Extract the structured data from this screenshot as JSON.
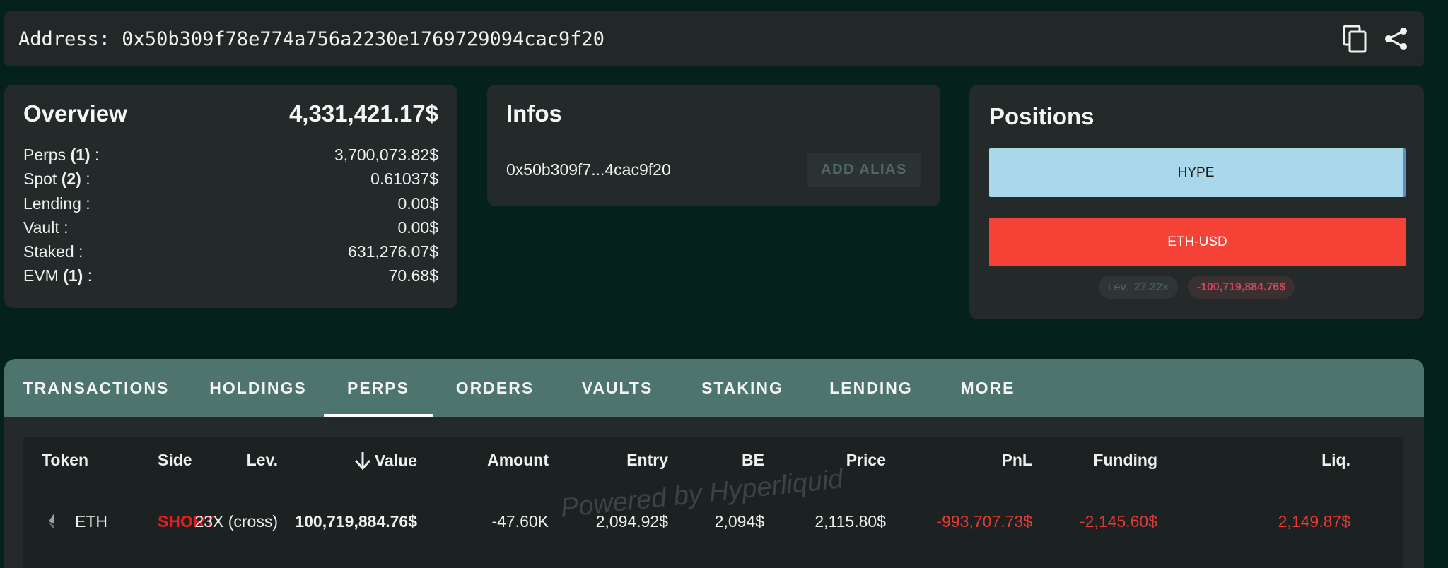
{
  "address_bar": {
    "label": "Address: 0x50b309f78e774a756a2230e1769729094cac9f20",
    "copy_icon": "copy-icon",
    "share_icon": "share-icon"
  },
  "overview": {
    "title": "Overview",
    "total": "4,331,421.17$",
    "rows": [
      {
        "label": "Perps ",
        "count": "(1)",
        "suffix": " :",
        "value": "3,700,073.82$"
      },
      {
        "label": "Spot ",
        "count": "(2)",
        "suffix": " :",
        "value": "0.61037$"
      },
      {
        "label": "Lending :",
        "count": "",
        "suffix": "",
        "value": "0.00$"
      },
      {
        "label": "Vault :",
        "count": "",
        "suffix": "",
        "value": "0.00$"
      },
      {
        "label": "Staked :",
        "count": "",
        "suffix": "",
        "value": "631,276.07$"
      },
      {
        "label": "EVM ",
        "count": "(1)",
        "suffix": " :",
        "value": "70.68$"
      }
    ]
  },
  "infos": {
    "title": "Infos",
    "short_address": "0x50b309f7...4cac9f20",
    "alias_button": "ADD ALIAS"
  },
  "positions": {
    "title": "Positions",
    "items": [
      "HYPE",
      "ETH-USD"
    ],
    "leverage_label": "Lev.",
    "leverage_value": "27.22x",
    "pnl": "-100,719,884.76$"
  },
  "tabs": [
    "TRANSACTIONS",
    "HOLDINGS",
    "PERPS",
    "ORDERS",
    "VAULTS",
    "STAKING",
    "LENDING",
    "MORE"
  ],
  "active_tab": "PERPS",
  "table": {
    "headers": [
      "Token",
      "Side",
      "Lev.",
      "Value",
      "Amount",
      "Entry",
      "BE",
      "Price",
      "PnL",
      "Funding",
      "Liq."
    ],
    "sort_icon": "arrow-down-icon",
    "watermark": "Powered by Hyperliquid",
    "rows": [
      {
        "token_icon": "ethereum-icon",
        "token": "ETH",
        "side": "SHORT",
        "lev": "23X (cross)",
        "value": "100,719,884.76$",
        "amount": "-47.60K",
        "entry": "2,094.92$",
        "be": "2,094$",
        "price": "2,115.80$",
        "pnl": "-993,707.73$",
        "funding": "-2,145.60$",
        "liq": "2,149.87$"
      }
    ]
  },
  "colors": {
    "background": "#042219",
    "card": "#232a29",
    "tab_bar": "#4d756d",
    "hype": "#a8d8ea",
    "eth": "#f44336",
    "negative": "#e53935"
  }
}
